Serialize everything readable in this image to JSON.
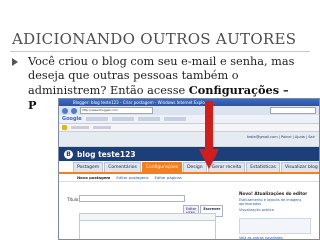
{
  "slide": {
    "title": "ADICIONANDO OUTROS AUTORES",
    "line1": "Você criou o blog com seu e-mail e senha, mas",
    "line2": "deseja que outras pessoas também o",
    "line3_plain": "administrem? Então acesse ",
    "line3_bold": "Configurações –",
    "line4_bold": "P"
  },
  "screenshot": {
    "window_title": "Blogger: blog teste123 - Criar postagem - Windows Internet Explorer",
    "address": "http://www.blogger.com",
    "google_label": "Google",
    "account_line": "teste@gmail.com | Painel | Ajuda | Sair",
    "blog_name": "blog teste123",
    "blogger_logo": "B",
    "tabs": [
      "Postagem",
      "Comentários",
      "Configurações",
      "Design",
      "Gerar receita",
      "Estatísticas",
      "Visualizar blog"
    ],
    "subtabs": [
      "Nova postagem",
      "Editar postagens",
      "Editar páginas"
    ],
    "title_label": "Título:",
    "editor_tabs": [
      "Editar HTML",
      "Escrever"
    ],
    "side_heading": "Novo! Atualizações do editor",
    "side_items": [
      "Estilizamento e layouts de imagens aprimorados",
      "Visualização prática"
    ],
    "side_link": "Veja as outras novidades"
  },
  "colors": {
    "arrow": "#d21d1d",
    "active_tab": "#f37f1f",
    "header": "#1c3f7a"
  }
}
